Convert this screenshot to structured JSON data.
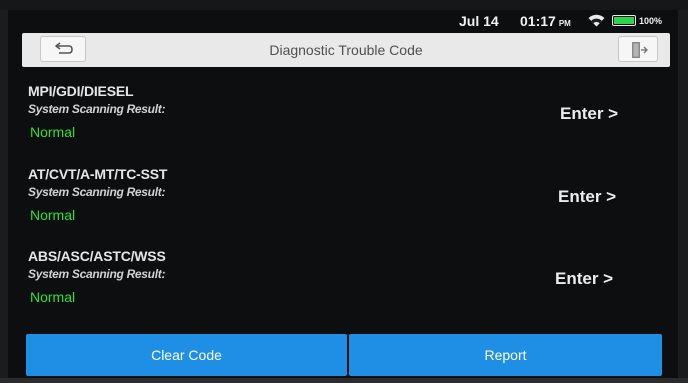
{
  "status_bar": {
    "date": "Jul 14",
    "time": "01:17",
    "ampm": "PM",
    "battery_text": "100%",
    "battery_level": 1.0,
    "icons": [
      "wifi-icon",
      "battery-icon"
    ]
  },
  "header": {
    "title": "Diagnostic Trouble Code",
    "back_icon": "back-arrow-icon",
    "exit_icon": "exit-door-icon"
  },
  "systems": [
    {
      "name": "MPI/GDI/DIESEL",
      "scan_label": "System Scanning Result:",
      "status": "Normal",
      "enter_label": "Enter >"
    },
    {
      "name": "AT/CVT/A-MT/TC-SST",
      "scan_label": "System Scanning Result:",
      "status": "Normal",
      "enter_label": "Enter >"
    },
    {
      "name": "ABS/ASC/ASTC/WSS",
      "scan_label": "System Scanning Result:",
      "status": "Normal",
      "enter_label": "Enter >"
    }
  ],
  "footer": {
    "clear_code": "Clear Code",
    "report": "Report"
  },
  "colors": {
    "accent": "#1f8fe6",
    "status_ok": "#2ee03b",
    "background": "#0d0e10",
    "header_bg": "#e9e9e9"
  }
}
